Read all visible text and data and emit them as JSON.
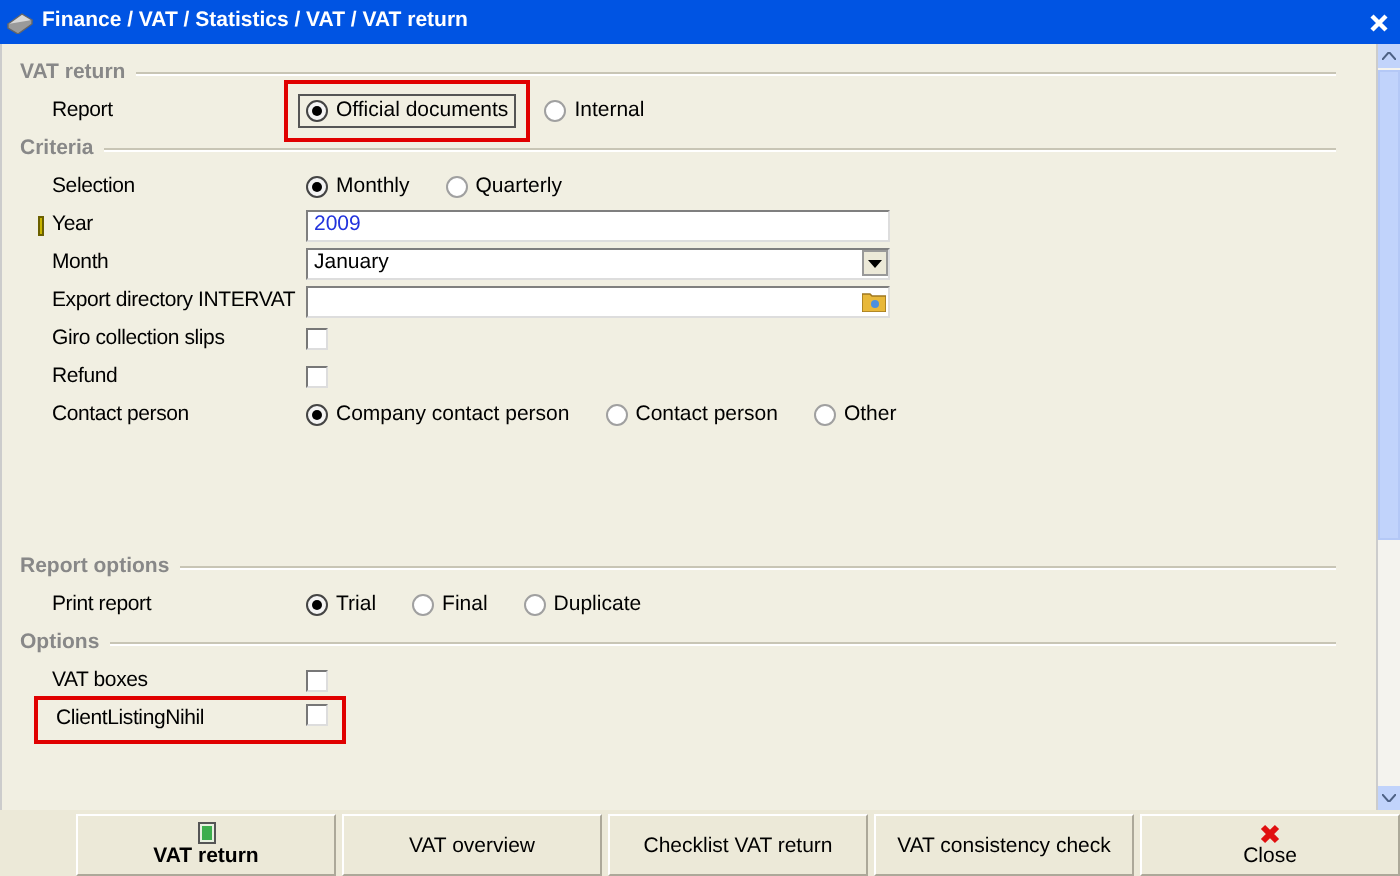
{
  "window": {
    "title": "Finance / VAT / Statistics / VAT / VAT return"
  },
  "sections": [
    {
      "title": "VAT return",
      "rows": [
        {
          "kind": "radio",
          "label": "Report",
          "options": [
            {
              "label": "Official documents",
              "selected": true,
              "highlighted": true
            },
            {
              "label": "Internal",
              "selected": false,
              "highlighted": false
            }
          ]
        }
      ]
    },
    {
      "title": "Criteria",
      "rows": [
        {
          "kind": "radio",
          "label": "Selection",
          "options": [
            {
              "label": "Monthly",
              "selected": true,
              "highlighted": false
            },
            {
              "label": "Quarterly",
              "selected": false,
              "highlighted": false
            }
          ]
        },
        {
          "kind": "text",
          "label": "Year",
          "value": "2009",
          "required": true
        },
        {
          "kind": "dropdown",
          "label": "Month",
          "value": "January"
        },
        {
          "kind": "folder",
          "label": "Export directory INTERVAT"
        },
        {
          "kind": "checkbox",
          "label": "Giro collection slips",
          "checked": false,
          "highlighted": false
        },
        {
          "kind": "checkbox",
          "label": "Refund",
          "checked": false,
          "highlighted": false
        },
        {
          "kind": "radio",
          "label": "Contact person",
          "options": [
            {
              "label": "Company contact person",
              "selected": true,
              "highlighted": false
            },
            {
              "label": "Contact person",
              "selected": false,
              "highlighted": false
            },
            {
              "label": "Other",
              "selected": false,
              "highlighted": false
            }
          ]
        }
      ]
    },
    {
      "title": "Report options",
      "rows": [
        {
          "kind": "radio",
          "label": "Print report",
          "options": [
            {
              "label": "Trial",
              "selected": true,
              "highlighted": false
            },
            {
              "label": "Final",
              "selected": false,
              "highlighted": false
            },
            {
              "label": "Duplicate",
              "selected": false,
              "highlighted": false
            }
          ]
        }
      ]
    },
    {
      "title": "Options",
      "rows": [
        {
          "kind": "checkbox",
          "label": "VAT boxes",
          "checked": false,
          "highlighted": false
        },
        {
          "kind": "checkbox",
          "label": "ClientListingNihil",
          "checked": false,
          "highlighted": true
        }
      ]
    }
  ],
  "buttons": [
    {
      "label": "VAT return",
      "bold": true
    },
    {
      "label": "VAT overview",
      "bold": false
    },
    {
      "label": "Checklist VAT return",
      "bold": false
    },
    {
      "label": "VAT consistency check",
      "bold": false
    },
    {
      "label": "Close",
      "bold": false
    }
  ]
}
